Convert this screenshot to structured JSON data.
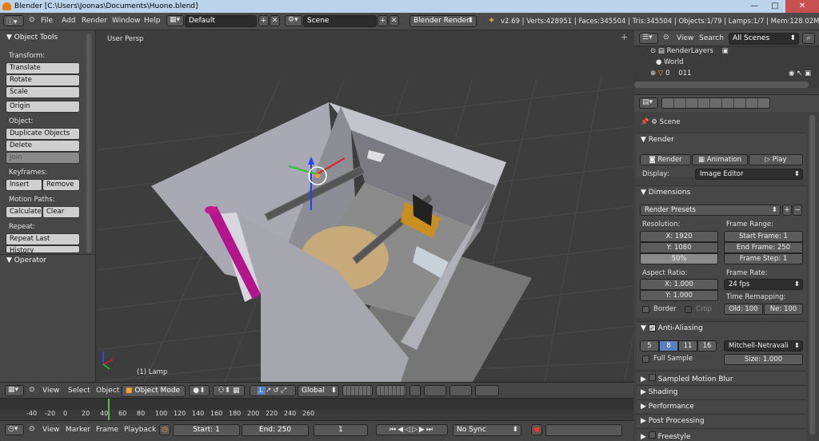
{
  "window": {
    "title": "Blender [C:\\Users\\Joonas\\Documents\\Huone.blend]",
    "minimize": "—",
    "maximize": "□",
    "close": "✕"
  },
  "infobar": {
    "menus": [
      "File",
      "Add",
      "Render",
      "Window",
      "Help"
    ],
    "screen": "Default",
    "scene": "Scene",
    "engine": "Blender Render",
    "stats": "v2.69 | Verts:428951 | Faces:345504 | Tris:345504 | Objects:1/79 | Lamps:1/7 | Mem:128.02M (0.11M)"
  },
  "tools": {
    "panel_title": "Object Tools",
    "transform": {
      "heading": "Transform:",
      "translate": "Translate",
      "rotate": "Rotate",
      "scale": "Scale"
    },
    "origin": "Origin",
    "object": {
      "heading": "Object:",
      "duplicate": "Duplicate Objects",
      "delete": "Delete",
      "join": "Join"
    },
    "keyframes": {
      "heading": "Keyframes:",
      "insert": "Insert",
      "remove": "Remove"
    },
    "motion_paths": {
      "heading": "Motion Paths:",
      "calculate": "Calculate",
      "clear": "Clear"
    },
    "repeat": {
      "heading": "Repeat:",
      "repeat_last": "Repeat Last",
      "history": "History"
    },
    "operator_title": "Operator"
  },
  "viewport": {
    "label": "User Persp",
    "selection": "(1) Lamp",
    "header": {
      "view": "View",
      "select": "Select",
      "object": "Object",
      "mode": "Object Mode",
      "orientation": "Global"
    }
  },
  "timeline": {
    "ticks": [
      "-40",
      "-20",
      "0",
      "20",
      "40",
      "60",
      "80",
      "100",
      "120",
      "140",
      "160",
      "180",
      "200",
      "220",
      "240",
      "260"
    ],
    "current_frame": 1,
    "menus": {
      "view": "View",
      "marker": "Marker",
      "frame": "Frame",
      "playback": "Playback"
    },
    "start": "Start: 1",
    "end": "End: 250",
    "frame": "1",
    "sync": "No Sync"
  },
  "outliner": {
    "view": "View",
    "search": "Search",
    "scenes": "All Scenes",
    "items": [
      "RenderLayers",
      "World",
      "0",
      "011"
    ]
  },
  "properties": {
    "context": "Scene",
    "render": {
      "title": "Render",
      "render_btn": "Render",
      "animation_btn": "Animation",
      "play_btn": "Play",
      "display_label": "Display:",
      "display_value": "Image Editor"
    },
    "dimensions": {
      "title": "Dimensions",
      "presets": "Render Presets",
      "resolution_label": "Resolution:",
      "res_x": "X: 1920",
      "res_y": "Y: 1080",
      "res_pct": "50%",
      "frame_range_label": "Frame Range:",
      "start_frame": "Start Frame: 1",
      "end_frame": "End Frame: 250",
      "frame_step": "Frame Step: 1",
      "aspect_label": "Aspect Ratio:",
      "aspect_x": "X: 1.000",
      "aspect_y": "Y: 1.000",
      "frame_rate_label": "Frame Rate:",
      "frame_rate": "24 fps",
      "time_remap_label": "Time Remapping:",
      "old": "Old: 100",
      "new": "Ne: 100",
      "border": "Border",
      "crop": "Crop"
    },
    "anti_aliasing": {
      "title": "Anti-Aliasing",
      "samples": [
        "5",
        "8",
        "11",
        "16"
      ],
      "selected_sample": "8",
      "filter": "Mitchell-Netravali",
      "full_sample": "Full Sample",
      "size": "Size: 1.000"
    },
    "collapsed": [
      "Sampled Motion Blur",
      "Shading",
      "Performance",
      "Post Processing",
      "Freestyle"
    ]
  },
  "colors": {
    "accent_blue": "#5680c2",
    "title_bar": "#bcd3ec",
    "panel": "#474747",
    "viewport_bg": "#3d3d3d"
  }
}
